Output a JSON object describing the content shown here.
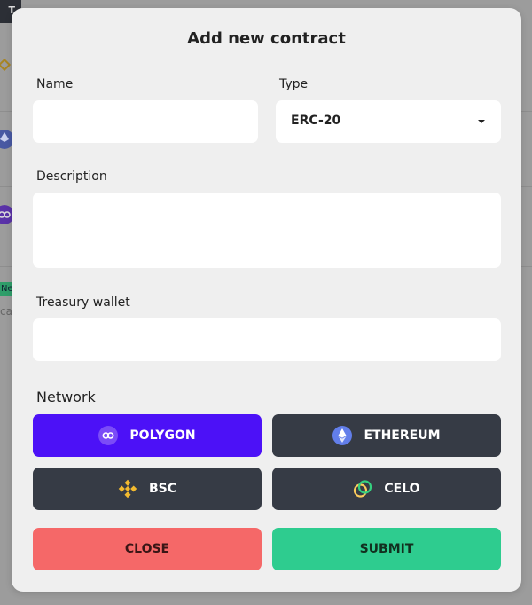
{
  "modal": {
    "title": "Add new contract",
    "name": {
      "label": "Name",
      "value": "",
      "placeholder": ""
    },
    "type": {
      "label": "Type",
      "selected": "ERC-20"
    },
    "description": {
      "label": "Description",
      "value": ""
    },
    "treasury": {
      "label": "Treasury wallet",
      "value": ""
    },
    "network": {
      "label": "Network",
      "options": [
        {
          "label": "POLYGON",
          "icon": "polygon-icon",
          "selected": true
        },
        {
          "label": "ETHEREUM",
          "icon": "ethereum-icon",
          "selected": false
        },
        {
          "label": "BSC",
          "icon": "bsc-icon",
          "selected": false
        },
        {
          "label": "CELO",
          "icon": "celo-icon",
          "selected": false
        }
      ]
    },
    "actions": {
      "close": "CLOSE",
      "submit": "SUBMIT"
    }
  },
  "background": {
    "chip_text": "T",
    "badge_text": "Ne",
    "row_text": "ca"
  },
  "colors": {
    "polygon": "#4c11f7",
    "dark_button": "#363b45",
    "close": "#f56868",
    "submit": "#2ecc8f",
    "bsc": "#f3ba2f",
    "ethereum": "#627eea"
  }
}
